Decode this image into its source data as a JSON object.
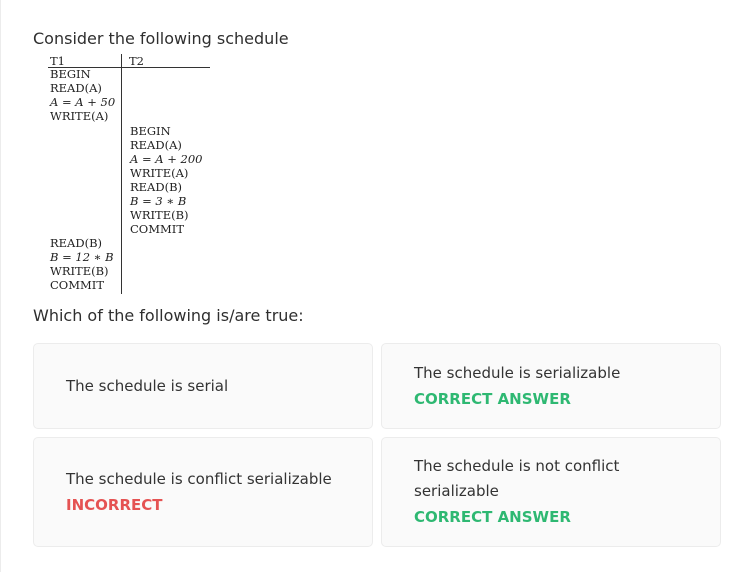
{
  "question": {
    "intro": "Consider the following schedule",
    "prompt": "Which of the following is/are true:"
  },
  "schedule": {
    "headers": [
      "T1",
      "T2"
    ],
    "t1_first": [
      "BEGIN",
      "READ(A)",
      "A = A + 50",
      "WRITE(A)"
    ],
    "t2_ops": [
      "BEGIN",
      "READ(A)",
      "A = A + 200",
      "WRITE(A)",
      "READ(B)",
      "B = 3 ∗ B",
      "WRITE(B)",
      "COMMIT"
    ],
    "t1_second": [
      "READ(B)",
      "B = 12 ∗ B",
      "WRITE(B)",
      "COMMIT"
    ]
  },
  "options": [
    {
      "text": "The schedule is serial",
      "status": ""
    },
    {
      "text": "The schedule is serializable",
      "status": "CORRECT ANSWER"
    },
    {
      "text": "The schedule is conflict serializable",
      "status": "INCORRECT"
    },
    {
      "text": "The schedule is not conflict serializable",
      "status": "CORRECT ANSWER"
    }
  ],
  "colors": {
    "correct": "#2eb872",
    "incorrect": "#e55353"
  }
}
